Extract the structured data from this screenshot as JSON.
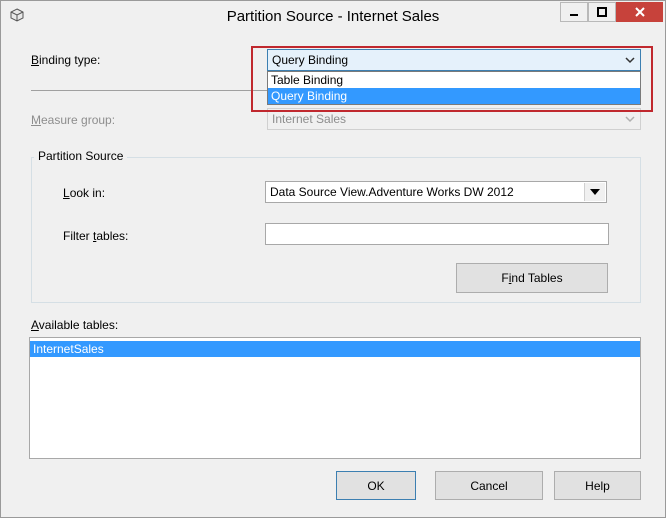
{
  "window": {
    "title": "Partition Source - Internet Sales",
    "icon": "cube-icon"
  },
  "binding": {
    "label_u": "B",
    "label_rest": "inding type:",
    "selected": "Query Binding",
    "options": [
      "Table Binding",
      "Query Binding"
    ],
    "selected_index": 1
  },
  "measure_group": {
    "label_u": "M",
    "label_rest": "easure group:",
    "value": "Internet Sales"
  },
  "partition_source": {
    "title": "Partition Source",
    "look_in_pre": "",
    "look_in_u": "L",
    "look_in_rest": "ook in:",
    "look_in_value": "Data Source View.Adventure Works DW 2012",
    "filter_pre": "Filter ",
    "filter_u": "t",
    "filter_rest": "ables:",
    "filter_value": "",
    "find_pre": "F",
    "find_u": "i",
    "find_rest": "nd Tables"
  },
  "available": {
    "label_u": "A",
    "label_rest": "vailable tables:",
    "items": [
      "InternetSales"
    ]
  },
  "buttons": {
    "ok": "OK",
    "cancel": "Cancel",
    "help": "Help"
  },
  "colors": {
    "selection": "#3399ff",
    "highlight_border": "#c0282e",
    "close_button": "#c7423b"
  }
}
